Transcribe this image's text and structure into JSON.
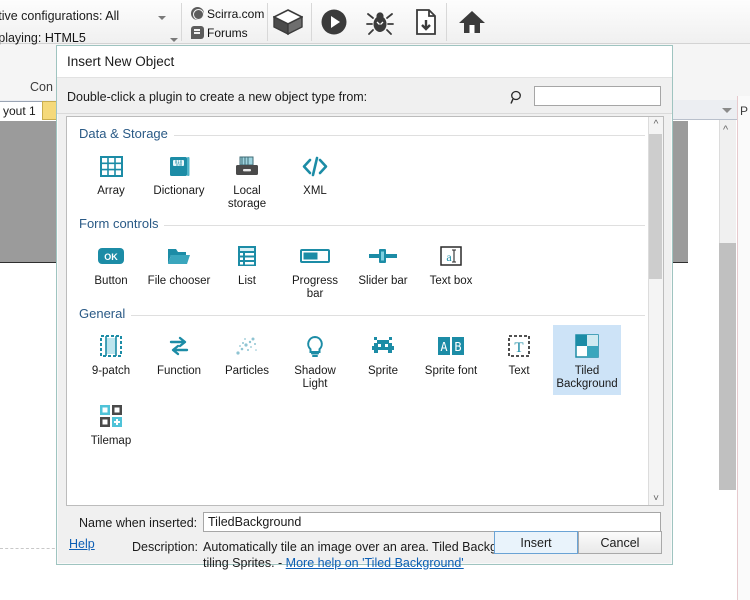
{
  "background": {
    "config_row_label": "ctive configurations:",
    "config_row_value": "All",
    "displaying_label": "splaying:",
    "displaying_value": "HTML5",
    "links": [
      {
        "label": "Scirra.com",
        "icon": "globe-icon"
      },
      {
        "label": "Forums",
        "icon": "forum-icon"
      }
    ],
    "toolbar_icons": [
      "box-icon",
      "play-icon",
      "debug-bug-icon",
      "export-file-icon",
      "home-icon"
    ],
    "panel_label": "Con",
    "tab_label": "yout 1",
    "properties_label": "P"
  },
  "dialog": {
    "title": "Insert New Object",
    "instruction": "Double-click a plugin to create a new object type from:",
    "search": {
      "value": "",
      "placeholder": ""
    },
    "groups": [
      {
        "title": "Data & Storage",
        "items": [
          {
            "label": "Array",
            "icon": "array-grid-icon"
          },
          {
            "label": "Dictionary",
            "icon": "dictionary-book-icon"
          },
          {
            "label": "Local storage",
            "icon": "local-storage-drive-icon"
          },
          {
            "label": "XML",
            "icon": "xml-code-icon"
          }
        ]
      },
      {
        "title": "Form controls",
        "items": [
          {
            "label": "Button",
            "icon": "ok-button-icon"
          },
          {
            "label": "File chooser",
            "icon": "folder-open-icon"
          },
          {
            "label": "List",
            "icon": "list-icon"
          },
          {
            "label": "Progress bar",
            "icon": "progress-bar-icon"
          },
          {
            "label": "Slider bar",
            "icon": "slider-bar-icon"
          },
          {
            "label": "Text box",
            "icon": "text-box-icon"
          }
        ]
      },
      {
        "title": "General",
        "items": [
          {
            "label": "9-patch",
            "icon": "nine-patch-icon"
          },
          {
            "label": "Function",
            "icon": "function-arrows-icon"
          },
          {
            "label": "Particles",
            "icon": "particles-icon"
          },
          {
            "label": "Shadow Light",
            "icon": "shadow-light-bulb-icon"
          },
          {
            "label": "Sprite",
            "icon": "sprite-invader-icon"
          },
          {
            "label": "Sprite font",
            "icon": "sprite-font-ab-icon"
          },
          {
            "label": "Text",
            "icon": "text-t-icon"
          },
          {
            "label": "Tiled Background",
            "icon": "tiled-background-icon",
            "selected": true
          },
          {
            "label": "Tilemap",
            "icon": "tilemap-icon"
          }
        ]
      }
    ],
    "name_label": "Name when inserted:",
    "name_value": "TiledBackground",
    "description_label": "Description:",
    "description_text": "Automatically tile an image over an area.  Tiled Backgrounds are much faster than tiling Sprites. - ",
    "description_link": "More help on 'Tiled Background'",
    "help_label": "Help",
    "insert_label": "Insert",
    "cancel_label": "Cancel"
  },
  "colors": {
    "icon_teal": "#1c8ca6",
    "selection_blue": "#cde3f7",
    "link_blue": "#0d5fb5",
    "group_title_blue": "#2a5a86",
    "dialog_border": "#9fc4c0"
  }
}
